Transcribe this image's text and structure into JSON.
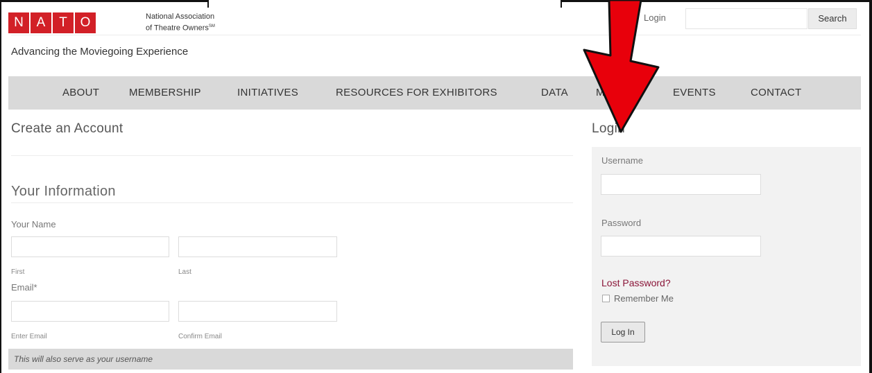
{
  "header": {
    "logo_letters": [
      "N",
      "A",
      "T",
      "O"
    ],
    "org_name_line1": "National Association",
    "org_name_line2": "of Theatre Owners",
    "trademark": "SM",
    "tagline": "Advancing the Moviegoing Experience",
    "login_link": "Login",
    "search_button": "Search",
    "search_placeholder": ""
  },
  "nav": {
    "items": [
      "ABOUT",
      "MEMBERSHIP",
      "INITIATIVES",
      "RESOURCES FOR EXHIBITORS",
      "DATA",
      "MEDIA",
      "EVENTS",
      "CONTACT"
    ]
  },
  "main": {
    "page_title": "Create an Account",
    "section_title": "Your Information",
    "name_label": "Your Name",
    "first_label": "First",
    "last_label": "Last",
    "email_label": "Email*",
    "enter_email_label": "Enter Email",
    "confirm_email_label": "Confirm Email",
    "username_note": "This will also serve as your username"
  },
  "sidebar": {
    "title": "Login",
    "username_label": "Username",
    "password_label": "Password",
    "lost_password": "Lost Password?",
    "remember_me": "Remember Me",
    "login_button": "Log In"
  },
  "colors": {
    "brand_red": "#d22027",
    "nav_bg": "#d9d9d9",
    "link_maroon": "#8a1538",
    "arrow_red": "#e8000b"
  }
}
